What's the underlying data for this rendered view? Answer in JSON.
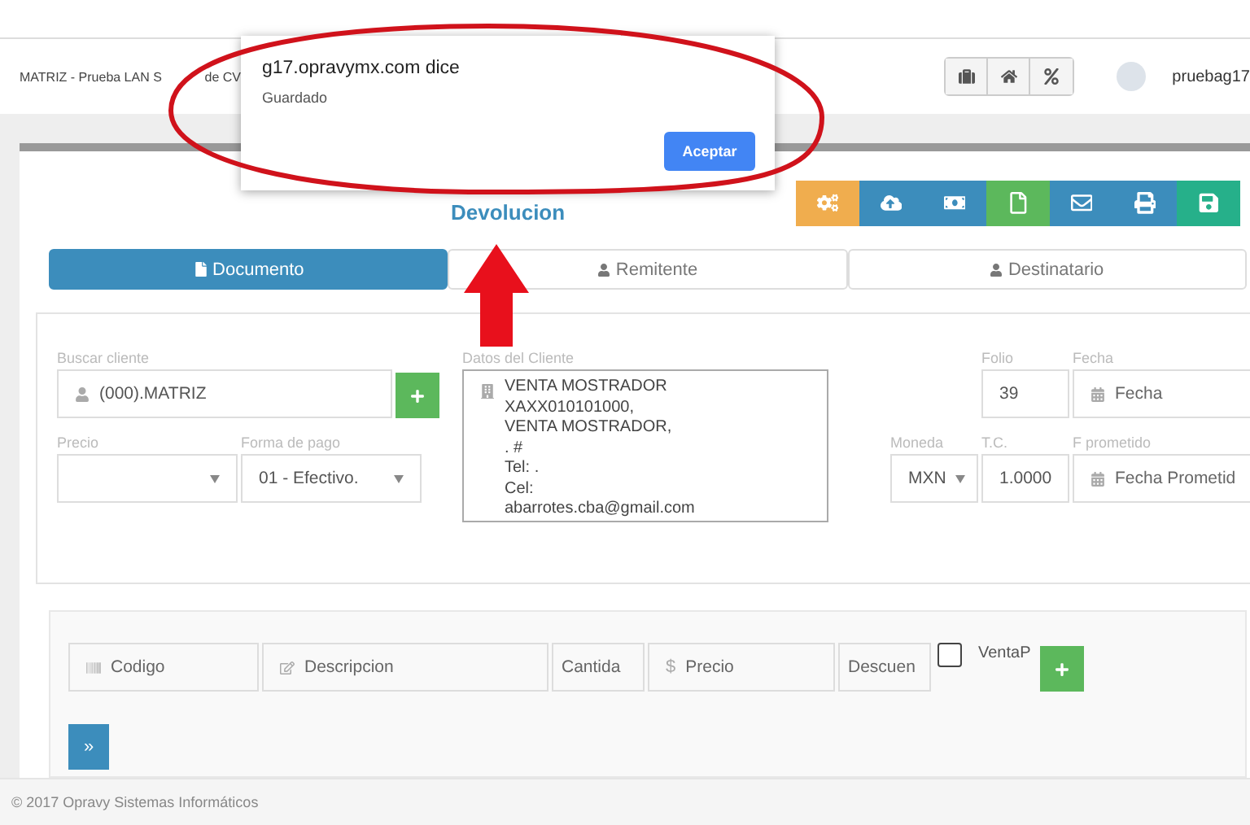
{
  "header": {
    "title_parts": [
      "MATRIZ - Prueba LAN S",
      "de CV"
    ],
    "user": "pruebag17"
  },
  "dialog": {
    "origin": "g17.opravymx.com dice",
    "message": "Guardado",
    "button": "Aceptar"
  },
  "page_title": "Devolucion",
  "tabs": [
    {
      "label": "Documento",
      "selected": true
    },
    {
      "label": "Remitente",
      "selected": false
    },
    {
      "label": "Destinatario",
      "selected": false
    }
  ],
  "client": {
    "label": "Buscar cliente",
    "value": "(000).MATRIZ"
  },
  "client_data": {
    "label": "Datos del Cliente",
    "lines": [
      "VENTA MOSTRADOR",
      "XAXX010101000,",
      "VENTA MOSTRADOR,",
      ". #",
      "Tel: .",
      "Cel:",
      "abarrotes.cba@gmail.com"
    ]
  },
  "price": {
    "label": "Precio"
  },
  "payment": {
    "label": "Forma de pago",
    "value": "01 - Efectivo."
  },
  "folio": {
    "label": "Folio",
    "value": "39"
  },
  "date": {
    "label": "Fecha",
    "placeholder": "Fecha"
  },
  "currency": {
    "label": "Moneda",
    "value": "MXN"
  },
  "rate": {
    "label": "T.C.",
    "value": "1.0000"
  },
  "promised": {
    "label": "F prometido",
    "placeholder": "Fecha Prometid"
  },
  "line_fields": [
    {
      "kind": "code",
      "placeholder": "Codigo"
    },
    {
      "kind": "description",
      "placeholder": "Descripcion"
    },
    {
      "kind": "plain",
      "placeholder": "Cantida"
    },
    {
      "kind": "money",
      "prefix": "$",
      "placeholder": "Precio"
    },
    {
      "kind": "plain",
      "placeholder": "Descuen"
    }
  ],
  "venta": {
    "label": "VentaP",
    "checked": false
  },
  "next_button": "»",
  "footer": "© 2017 Opravy Sistemas Informáticos"
}
